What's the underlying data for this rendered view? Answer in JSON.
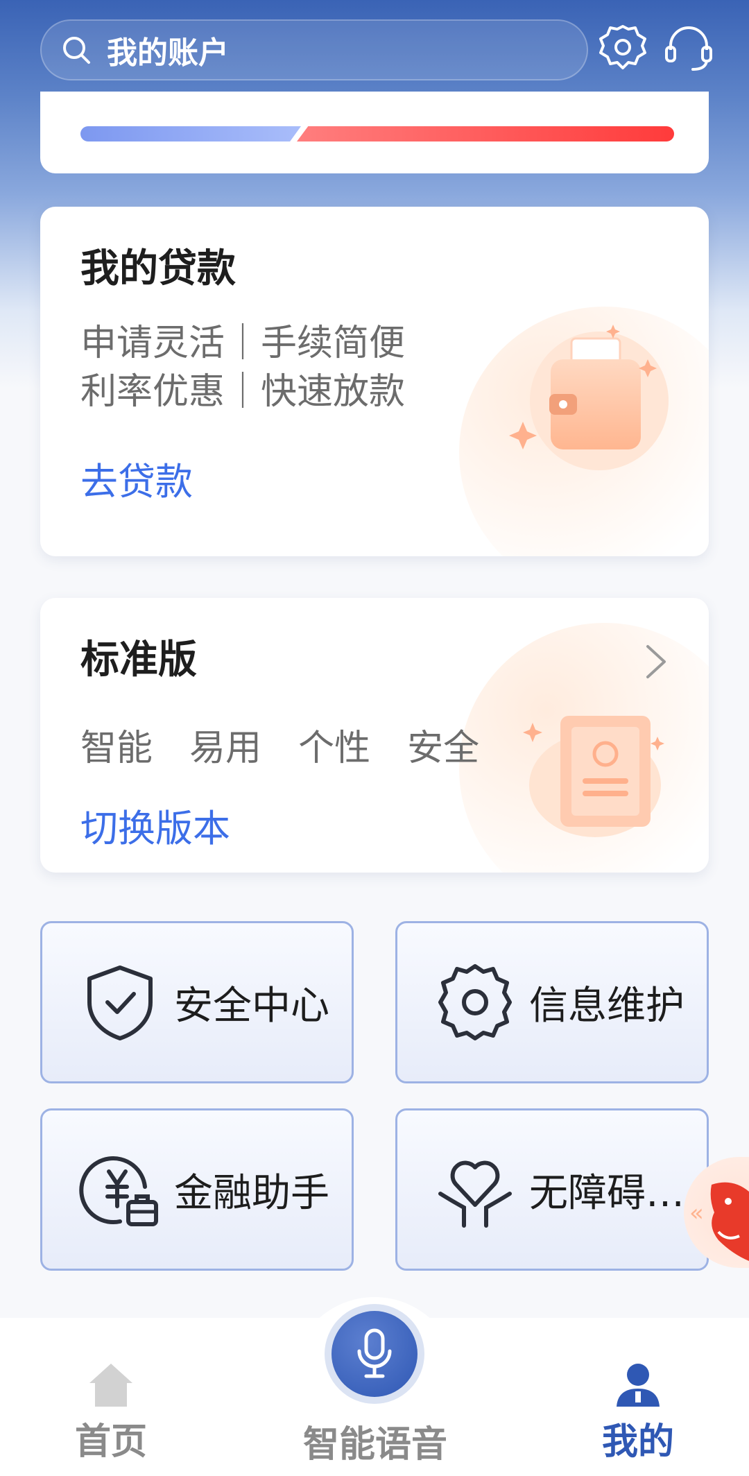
{
  "header": {
    "search_text": "我的账户",
    "icons": [
      "search-icon",
      "settings-icon",
      "customer-service-icon"
    ]
  },
  "progress": {
    "segments": [
      {
        "color": "#8ea6f4",
        "value": 0.3
      },
      {
        "color": "#ff4b4b",
        "value": 0.7
      }
    ]
  },
  "loan_card": {
    "title": "我的贷款",
    "line1": "申请灵活｜手续简便",
    "line2": "利率优惠｜快速放款",
    "link": "去贷款"
  },
  "version_card": {
    "title": "标准版",
    "features": "智能  易用  个性  安全",
    "link": "切换版本"
  },
  "tiles": [
    {
      "label": "安全中心",
      "icon": "shield-check-icon"
    },
    {
      "label": "信息维护",
      "icon": "gear-icon"
    },
    {
      "label": "金融助手",
      "icon": "yuan-briefcase-icon"
    },
    {
      "label": "无障碍…",
      "icon": "heart-hands-icon"
    }
  ],
  "bottom_nav": {
    "home": "首页",
    "voice": "智能语音",
    "mine": "我的",
    "active": "mine",
    "active_color": "#2f58b4"
  }
}
